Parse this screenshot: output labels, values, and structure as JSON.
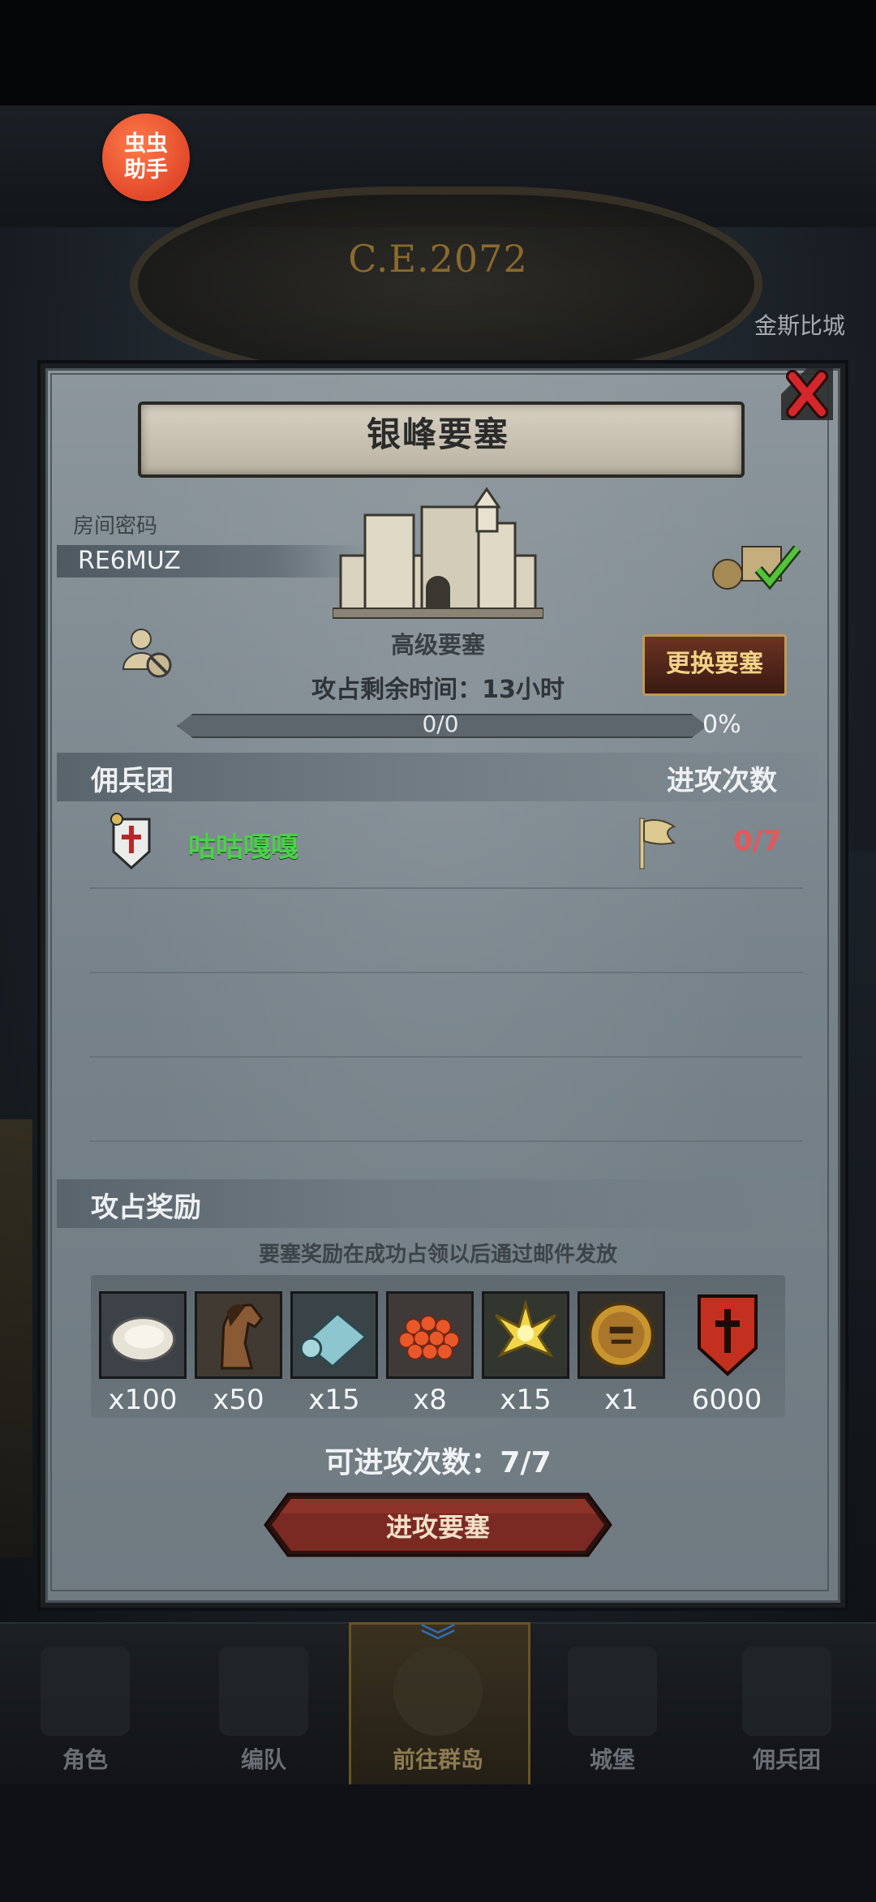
{
  "overlay_badge": {
    "label": "虫虫助手"
  },
  "hud": {
    "era": "C.E.2072",
    "city": "金斯比城"
  },
  "dialog": {
    "title": "银峰要塞",
    "room_password_label": "房间密码",
    "room_password": "RE6MUZ",
    "fortress_grade": "高级要塞",
    "time_remaining": "攻占剩余时间：13小时",
    "swap_button": "更换要塞",
    "progress": {
      "text": "0/0",
      "percent_label": "0%",
      "fraction": 0
    },
    "mercenary_header": "佣兵团",
    "attacks_header": "进攻次数",
    "mercenaries": [
      {
        "name": "咕咕嘎嘎",
        "attacks": "0/7"
      }
    ],
    "rewards_header": "攻占奖励",
    "rewards_note": "要塞奖励在成功占领以后通过邮件发放",
    "rewards": [
      {
        "icon": "oyster-icon",
        "qty": "x100"
      },
      {
        "icon": "horse-icon",
        "qty": "x50"
      },
      {
        "icon": "cloth-icon",
        "qty": "x15"
      },
      {
        "icon": "roe-icon",
        "qty": "x8"
      },
      {
        "icon": "golden-crest-icon",
        "qty": "x15"
      },
      {
        "icon": "helmet-medal-icon",
        "qty": "x1"
      },
      {
        "icon": "mercenary-banner-icon",
        "qty": "6000"
      }
    ],
    "attack_count": "可进攻次数：7/7",
    "attack_button": "进攻要塞"
  },
  "nav": [
    {
      "label": "角色",
      "icon": "knight-icon"
    },
    {
      "label": "编队",
      "icon": "helmet-icon"
    },
    {
      "label": "前往群岛",
      "icon": "compass-icon",
      "active": true
    },
    {
      "label": "城堡",
      "icon": "castle-icon"
    },
    {
      "label": "佣兵团",
      "icon": "mercenary-icon"
    }
  ],
  "colors": {
    "accent_gold": "#c09a55",
    "merc_name": "#4bd14a",
    "attack_red": "#e7575a",
    "button_red": "#7a2a22"
  }
}
